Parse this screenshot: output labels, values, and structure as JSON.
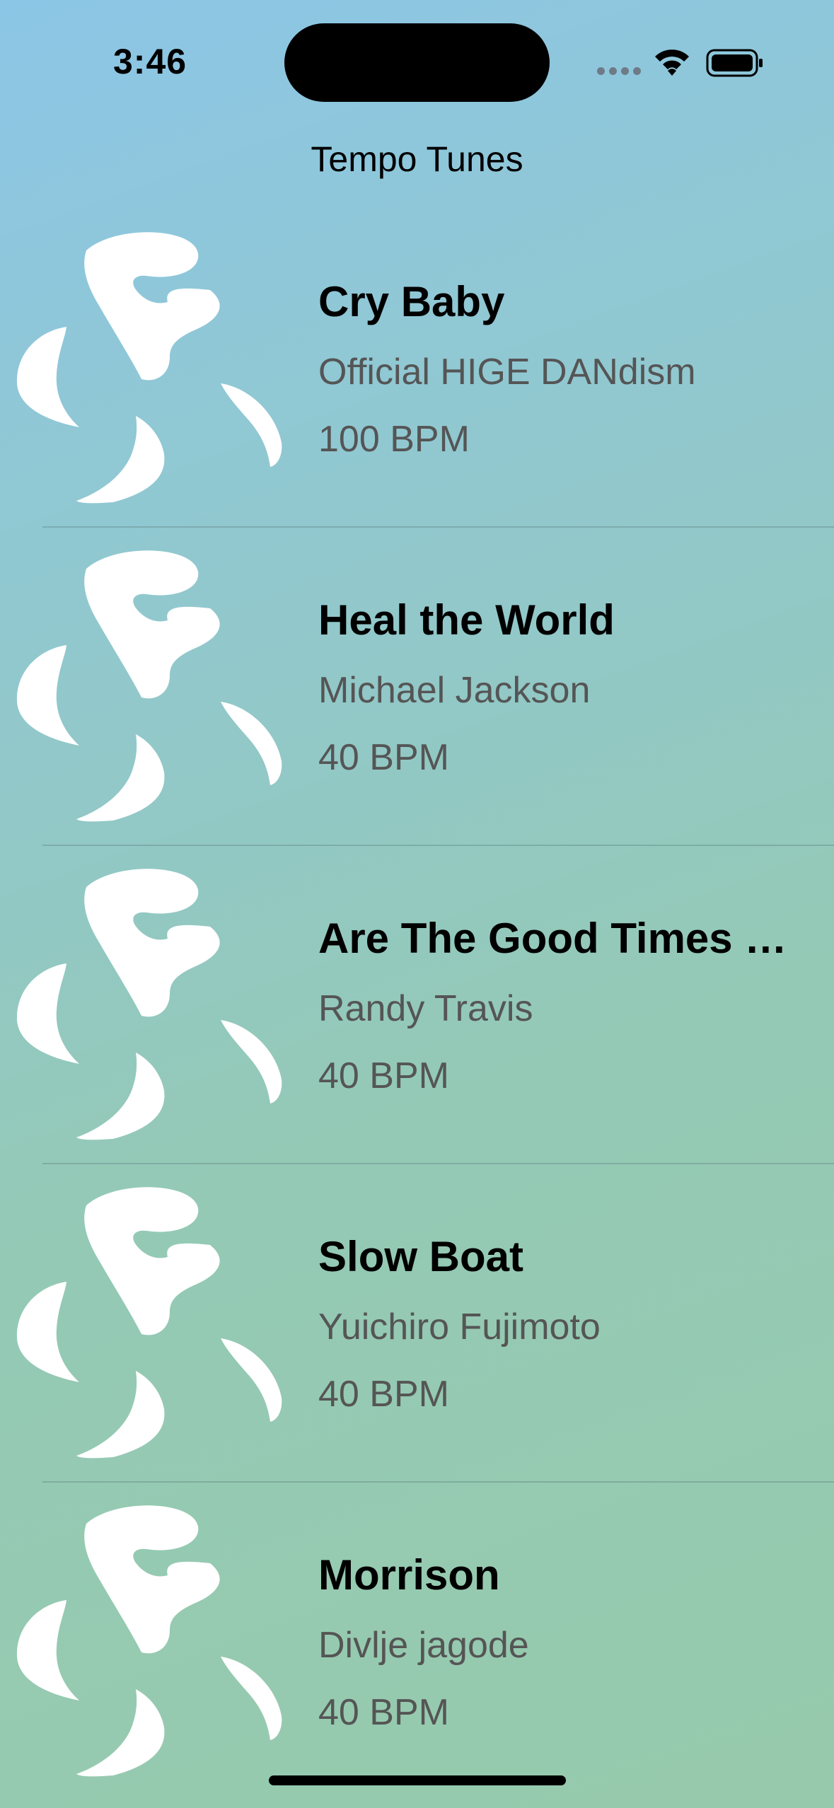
{
  "status_bar": {
    "time": "3:46"
  },
  "nav": {
    "title": "Tempo Tunes"
  },
  "songs": [
    {
      "title": "Cry Baby",
      "artist": "Official HIGE DANdism",
      "bpm": "100 BPM"
    },
    {
      "title": "Heal the World",
      "artist": "Michael Jackson",
      "bpm": "40 BPM"
    },
    {
      "title": "Are The Good Times R...",
      "artist": "Randy Travis",
      "bpm": "40 BPM"
    },
    {
      "title": "Slow Boat",
      "artist": "Yuichiro Fujimoto",
      "bpm": "40 BPM"
    },
    {
      "title": "Morrison",
      "artist": "Divlje jagode",
      "bpm": "40 BPM"
    }
  ],
  "icons": {
    "artwork": "music-note-artwork-icon",
    "wifi": "wifi-icon",
    "battery": "battery-icon",
    "signal": "signal-icon"
  },
  "colors": {
    "background_top": "#8cc6e6",
    "background_bottom": "#97caac",
    "artwork": "#ffffff",
    "secondary_text": "#555555"
  }
}
